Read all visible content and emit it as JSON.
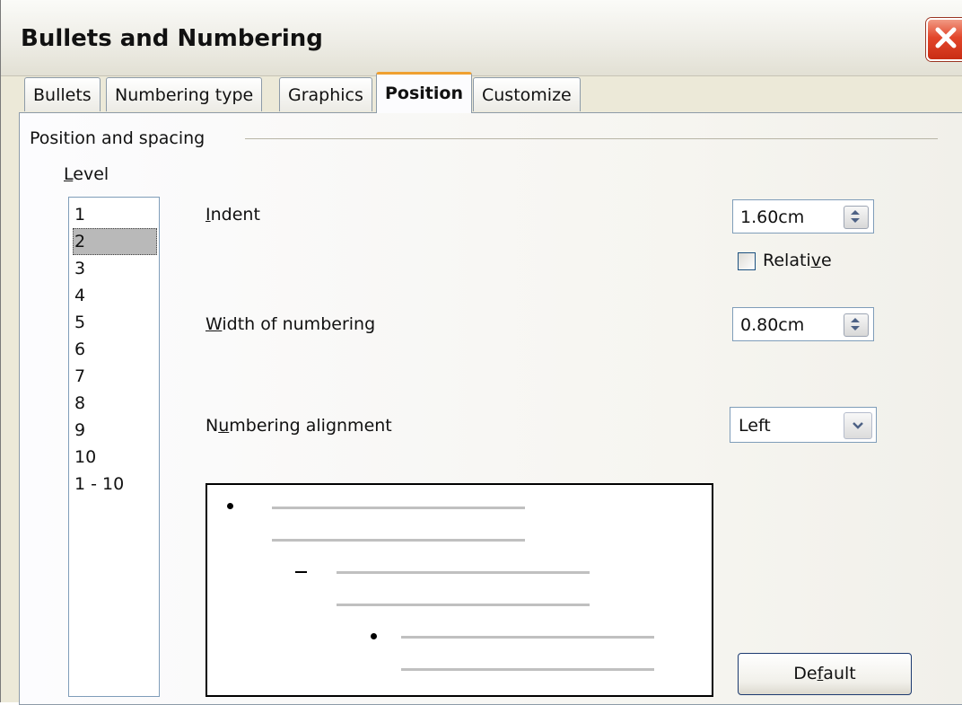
{
  "window": {
    "title": "Bullets and Numbering"
  },
  "tabs": [
    {
      "label": "Bullets",
      "active": false
    },
    {
      "label": "Numbering type",
      "active": false
    },
    {
      "label": "Graphics",
      "active": false
    },
    {
      "label": "Position",
      "active": true
    },
    {
      "label": "Customize",
      "active": false
    }
  ],
  "position_and_spacing": {
    "group_label": "Position and spacing",
    "level": {
      "label": "Level",
      "items": [
        "1",
        "2",
        "3",
        "4",
        "5",
        "6",
        "7",
        "8",
        "9",
        "10",
        "1 - 10"
      ],
      "selected": "2"
    },
    "indent": {
      "label": "Indent",
      "value": "1.60cm"
    },
    "relative": {
      "label": "Relative",
      "checked": false
    },
    "width_of_numbering": {
      "label": "Width of numbering",
      "value": "0.80cm"
    },
    "numbering_alignment": {
      "label": "Numbering alignment",
      "value": "Left"
    }
  },
  "buttons": {
    "default_label": "Default"
  },
  "colors": {
    "accent_tab": "#f0a030",
    "close_button": "#e2462b",
    "selection": "#b9b9b9"
  },
  "icons": [
    "close-icon",
    "spin-up-icon",
    "spin-down-icon",
    "dropdown-arrow-icon"
  ]
}
